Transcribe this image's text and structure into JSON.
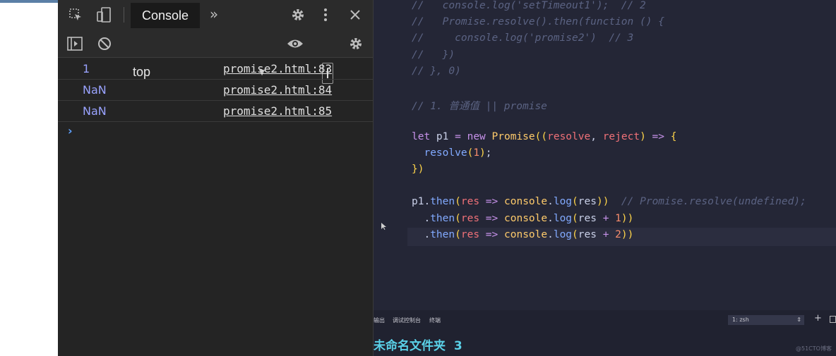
{
  "devtools": {
    "tabs": {
      "active": "Console",
      "more": "»"
    },
    "context": {
      "selected": "top",
      "arrow": "▼"
    },
    "toolbar_icons": [
      "inspect-icon",
      "device-toggle-icon",
      "gear-icon",
      "more-vertical-icon",
      "close-icon",
      "sidebar-toggle-icon",
      "clear-console-icon",
      "eye-icon",
      "settings-icon"
    ],
    "logs": [
      {
        "value": "1",
        "source": "promise2.html:83"
      },
      {
        "value": "NaN",
        "source": "promise2.html:84"
      },
      {
        "value": "NaN",
        "source": "promise2.html:85"
      }
    ],
    "prompt": "›"
  },
  "editor": {
    "lines": [
      [
        [
          "cm",
          "//   console.log('setTimeout1');  // 2"
        ]
      ],
      [
        [
          "cm",
          "//   Promise.resolve().then(function () {"
        ]
      ],
      [
        [
          "cm",
          "//     console.log('promise2')  // 3"
        ]
      ],
      [
        [
          "cm",
          "//   })"
        ]
      ],
      [
        [
          "cm",
          "// }, 0)"
        ]
      ],
      [],
      [
        [
          "cm",
          "// 1. 普通值 || promise"
        ]
      ],
      [],
      [
        [
          "kw",
          "let"
        ],
        [
          "tx",
          " p1 "
        ],
        [
          "kw",
          "="
        ],
        [
          "tx",
          " "
        ],
        [
          "kw",
          "new"
        ],
        [
          "tx",
          " "
        ],
        [
          "cls",
          "Promise"
        ],
        [
          "br",
          "(("
        ],
        [
          "pm",
          "resolve"
        ],
        [
          "tx",
          ", "
        ],
        [
          "pm",
          "reject"
        ],
        [
          "br",
          ")"
        ],
        [
          "tx",
          " "
        ],
        [
          "kw",
          "=>"
        ],
        [
          "tx",
          " "
        ],
        [
          "br",
          "{"
        ]
      ],
      [
        [
          "tx",
          "  "
        ],
        [
          "fn",
          "resolve"
        ],
        [
          "br",
          "("
        ],
        [
          "num",
          "1"
        ],
        [
          "br",
          ")"
        ],
        [
          "tx",
          ";"
        ]
      ],
      [
        [
          "br",
          "})"
        ]
      ],
      [],
      [
        [
          "tx",
          "p1."
        ],
        [
          "fn",
          "then"
        ],
        [
          "br",
          "("
        ],
        [
          "pm",
          "res"
        ],
        [
          "tx",
          " "
        ],
        [
          "kw",
          "=>"
        ],
        [
          "tx",
          " "
        ],
        [
          "cls",
          "console"
        ],
        [
          "tx",
          "."
        ],
        [
          "fn",
          "log"
        ],
        [
          "br",
          "("
        ],
        [
          "tx",
          "res"
        ],
        [
          "br",
          "))"
        ],
        [
          "tx",
          "  "
        ],
        [
          "cm",
          "// Promise.resolve(undefined);"
        ]
      ],
      [
        [
          "tx",
          "  ."
        ],
        [
          "fn",
          "then"
        ],
        [
          "br",
          "("
        ],
        [
          "pm",
          "res"
        ],
        [
          "tx",
          " "
        ],
        [
          "kw",
          "=>"
        ],
        [
          "tx",
          " "
        ],
        [
          "cls",
          "console"
        ],
        [
          "tx",
          "."
        ],
        [
          "fn",
          "log"
        ],
        [
          "br",
          "("
        ],
        [
          "tx",
          "res "
        ],
        [
          "kw",
          "+"
        ],
        [
          "tx",
          " "
        ],
        [
          "num",
          "1"
        ],
        [
          "br",
          "))"
        ]
      ],
      [
        [
          "tx",
          "  ."
        ],
        [
          "fn",
          "then"
        ],
        [
          "br",
          "("
        ],
        [
          "pm",
          "res"
        ],
        [
          "tx",
          " "
        ],
        [
          "kw",
          "=>"
        ],
        [
          "tx",
          " "
        ],
        [
          "cls",
          "console"
        ],
        [
          "tx",
          "."
        ],
        [
          "fn",
          "log"
        ],
        [
          "br",
          "("
        ],
        [
          "tx",
          "res "
        ],
        [
          "kw",
          "+"
        ],
        [
          "tx",
          " "
        ],
        [
          "num",
          "2"
        ],
        [
          "br",
          "))"
        ]
      ]
    ]
  },
  "terminal": {
    "tabs": [
      "输出",
      "调试控制台",
      "终端"
    ],
    "shell_select": "1: zsh",
    "shell_arrow": "⇕",
    "plus": "+",
    "prompt_line": "未命名文件夹  3"
  },
  "watermark": "@51CTO博客",
  "colors": {
    "devtools_bg": "#242424",
    "editor_bg": "#242636",
    "terminal_bg": "#202230",
    "accent": "#5ad1e8"
  }
}
